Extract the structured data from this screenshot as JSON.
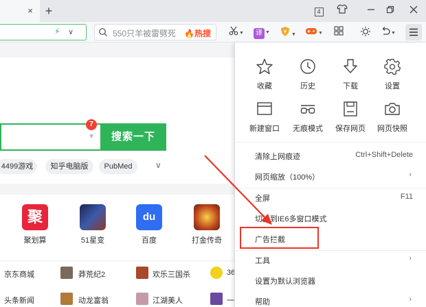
{
  "browser": {
    "tab_close": "×",
    "new_tab": "+",
    "tab_count": "4",
    "search_query": "550只羊被雷劈死",
    "search_hot": "🔥热搜",
    "translate_label": "译"
  },
  "page": {
    "search_button": "搜索一下",
    "badge_count": "7",
    "tags": [
      "4499游戏",
      "知乎电脑版",
      "PubMed"
    ],
    "apps": [
      {
        "label": "聚划算",
        "glyph": "聚",
        "color": "#e8253a"
      },
      {
        "label": "51星变",
        "glyph": "",
        "color": "#2b3d78"
      },
      {
        "label": "百度",
        "glyph": "du",
        "color": "#2f6ef2"
      },
      {
        "label": "打金传奇",
        "glyph": "",
        "color": "#c04a1d"
      }
    ],
    "links_row1": [
      "京东商城",
      "莽荒纪2",
      "欢乐三国杀",
      "36"
    ],
    "links_row2": [
      "头条新闻",
      "动龙富翁",
      "江湖美人",
      "一"
    ]
  },
  "menu": {
    "grid": [
      {
        "label": "收藏",
        "icon": "star-icon"
      },
      {
        "label": "历史",
        "icon": "clock-icon"
      },
      {
        "label": "下载",
        "icon": "download-icon"
      },
      {
        "label": "设置",
        "icon": "gear-icon"
      },
      {
        "label": "新建窗口",
        "icon": "window-icon"
      },
      {
        "label": "无痕模式",
        "icon": "glasses-icon"
      },
      {
        "label": "保存网页",
        "icon": "save-icon"
      },
      {
        "label": "网页快照",
        "icon": "camera-icon"
      }
    ],
    "items": [
      {
        "label": "清除上网痕迹",
        "right": "Ctrl+Shift+Delete"
      },
      {
        "label": "网页缩放（100%）",
        "right": "›"
      },
      {
        "label": "全屏",
        "right": "F11"
      },
      {
        "label": "切换到IE6多窗口模式",
        "right": ""
      },
      {
        "label": "广告拦截",
        "right": ""
      },
      {
        "label": "工具",
        "right": "›"
      },
      {
        "label": "设置为默认浏览器",
        "right": ""
      },
      {
        "label": "帮助",
        "right": "›"
      }
    ]
  },
  "colors": {
    "accent_green": "#2fb45a",
    "annotation_red": "#e8352b"
  }
}
